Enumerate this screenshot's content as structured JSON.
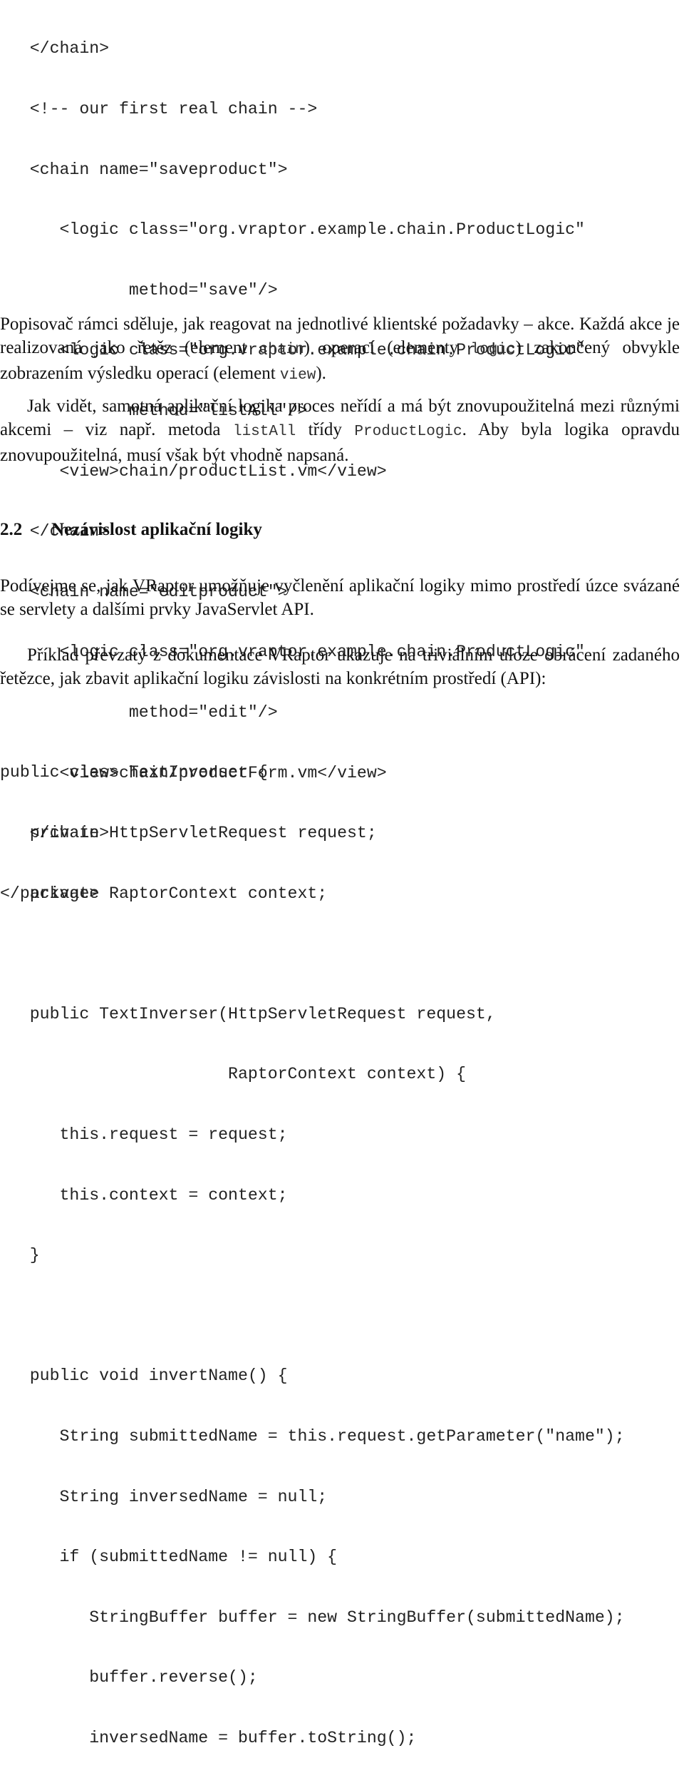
{
  "code_block_1": {
    "lines": [
      "   </chain>",
      "   <!-- our first real chain -->",
      "   <chain name=\"saveproduct\">",
      "      <logic class=\"org.vraptor.example.chain.ProductLogic\"",
      "             method=\"save\"/>",
      "      <logic class=\"org.vraptor.example.chain.ProductLogic\"",
      "             method=\"listAll\"/>",
      "      <view>chain/productList.vm</view>",
      "   </chain>",
      "   <chain name=\"editproduct\">",
      "      <logic class=\"org.vraptor.example.chain.ProductLogic\"",
      "             method=\"edit\"/>",
      "      <view>chain/productForm.vm</view>",
      "   </chain>",
      "</package>"
    ]
  },
  "paragraph_1": {
    "t1": "Popisovač rámci sděluje, jak reagovat na jednotlivé klientské požadavky – akce. Každá akce je realizovaná jako řetěz (element ",
    "c1": "chain",
    "t2": ") operací (elementy ",
    "c2": "logic",
    "t3": ") zakončený obvykle zobrazením výsledku operací (element ",
    "c3": "view",
    "t4": ")."
  },
  "paragraph_2": {
    "t1": "Jak vidět, samotná aplikační logika proces neřídí a má být znovupoužitelná mezi různými akcemi – viz např. metoda ",
    "c1": "listAll",
    "t2": " třídy ",
    "c2": "ProductLogic",
    "t3": ". Aby byla logika opravdu znovupoužitelná, musí však být vhodně napsaná."
  },
  "section_heading": {
    "number": "2.2",
    "title": "Nezávislost aplikační logiky"
  },
  "paragraph_3": "Podívejme se, jak VRaptor umožňuje vyčlenění aplikační logiky mimo prostředí úzce svázané se servlety a dalšími prvky JavaServlet API.",
  "paragraph_4": "Příklad převzatý z dokumentace VRaptor ukazuje na triviálním úloze obrácení zadaného řetězce, jak zbavit aplikační logiku závislosti na konkrétním prostředí (API):",
  "code_block_2": {
    "lines": [
      "public class TextInverser {",
      "   private HttpServletRequest request;",
      "   private RaptorContext context;",
      "",
      "   public TextInverser(HttpServletRequest request,",
      "                       RaptorContext context) {",
      "      this.request = request;",
      "      this.context = context;",
      "   }",
      "",
      "   public void invertName() {",
      "      String submittedName = this.request.getParameter(\"name\");",
      "      String inversedName = null;",
      "      if (submittedName != null) {",
      "         StringBuffer buffer = new StringBuffer(submittedName);",
      "         buffer.reverse();",
      "         inversedName = buffer.toString();"
    ]
  }
}
